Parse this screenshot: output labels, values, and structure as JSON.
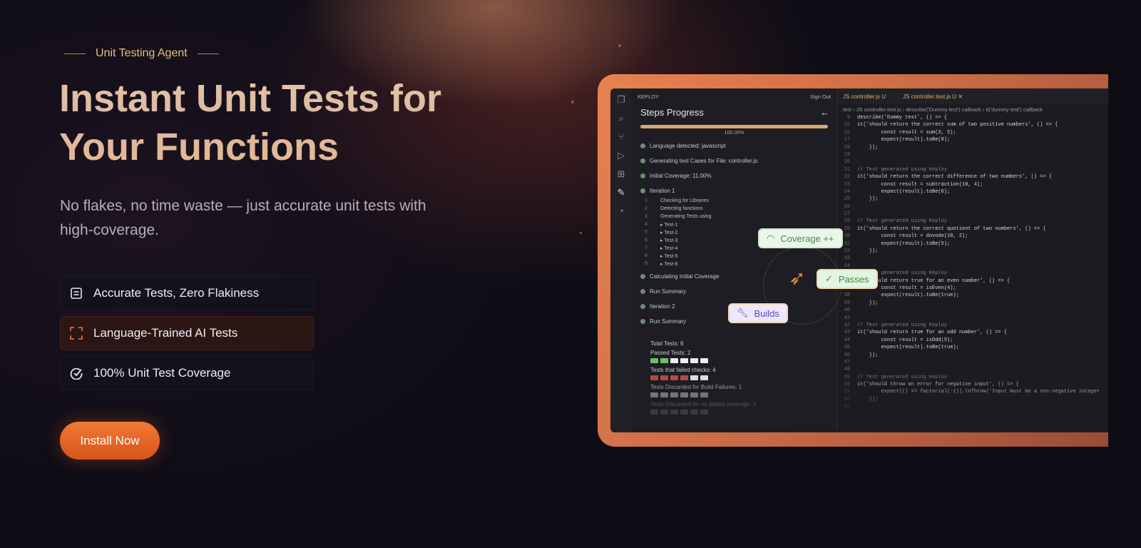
{
  "hero": {
    "eyebrow": "Unit Testing Agent",
    "title_line1": "Instant Unit Tests for",
    "title_line2": "Your Functions",
    "subtitle": "No flakes, no time waste — just accurate unit tests with high-coverage.",
    "features": [
      {
        "label": "Accurate Tests, Zero Flakiness",
        "icon": "document-icon"
      },
      {
        "label": "Language-Trained AI Tests",
        "icon": "scan-icon"
      },
      {
        "label": "100% Unit Test Coverage",
        "icon": "gauge-check-icon"
      }
    ],
    "cta": "Install Now"
  },
  "editor": {
    "panel": {
      "brand": "KEPLOY",
      "sign_out": "Sign Out",
      "title": "Steps Progress",
      "progress_value": "100.00%",
      "steps": [
        "Language detected:  javascript",
        "Generating test Cases for File:  controller.js.",
        "Initial Coverage:  11.00%",
        "Iteration 1"
      ],
      "substeps": [
        {
          "n": "1",
          "t": "Checking for Libraries"
        },
        {
          "n": "2",
          "t": "Detecting functions"
        },
        {
          "n": "3",
          "t": "Generating Tests using"
        },
        {
          "n": "4",
          "t": "▸ Test-1"
        },
        {
          "n": "5",
          "t": "▸ Test-2"
        },
        {
          "n": "6",
          "t": "▸ Test-3"
        },
        {
          "n": "7",
          "t": "▸ Test-4"
        },
        {
          "n": "8",
          "t": "▸ Test-5"
        },
        {
          "n": "9",
          "t": "▸ Test-6"
        }
      ],
      "steps2": [
        "Calculating Initial Coverage",
        "Run Summary",
        "Iteration 2",
        "Run Summary"
      ],
      "total": "Total Tests: 6",
      "passed": "Passed Tests: 2",
      "failed": "Tests that failed checks: 4",
      "discarded_build": "Tests Discarded for Build Failures: 1",
      "discarded_cov": "Tests Discarded for no added coverage: 3"
    },
    "tabs": [
      "JS controller.js U",
      "JS controller.test.js U  ✕"
    ],
    "breadcrumb": "test  ›  JS controller.test.js  ›  describe('Dummy test') callback  ›  it('dummy test') callback",
    "code": [
      {
        "n": "9",
        "t": "describe('Dummy test', () => {"
      },
      {
        "n": "15",
        "t": "it('should return the correct sum of two positive numbers', () => {"
      },
      {
        "n": "16",
        "t": "        const result = sum(3, 5);"
      },
      {
        "n": "17",
        "t": "        expect(result).toBe(8);"
      },
      {
        "n": "18",
        "t": "    });"
      },
      {
        "n": "19",
        "t": ""
      },
      {
        "n": "20",
        "t": ""
      },
      {
        "n": "21",
        "t": "// Test generated using Keploy"
      },
      {
        "n": "22",
        "t": "it('should return the correct difference of two numbers', () => {"
      },
      {
        "n": "23",
        "t": "        const result = subtraction(10, 4);"
      },
      {
        "n": "24",
        "t": "        expect(result).toBe(6);"
      },
      {
        "n": "25",
        "t": "    });"
      },
      {
        "n": "26",
        "t": ""
      },
      {
        "n": "27",
        "t": ""
      },
      {
        "n": "28",
        "t": "// Test generated using Keploy"
      },
      {
        "n": "29",
        "t": "it('should return the correct quotient of two numbers', () => {"
      },
      {
        "n": "30",
        "t": "        const result = dovode(10, 2);"
      },
      {
        "n": "31",
        "t": "        expect(result).toBe(5);"
      },
      {
        "n": "32",
        "t": "    });"
      },
      {
        "n": "33",
        "t": ""
      },
      {
        "n": "34",
        "t": ""
      },
      {
        "n": "35",
        "t": "// Test generated using Keploy"
      },
      {
        "n": "36",
        "t": "it('should return true for an even number', () => {"
      },
      {
        "n": "37",
        "t": "        const result = isEven(4);"
      },
      {
        "n": "38",
        "t": "        expect(result).toBe(true);"
      },
      {
        "n": "39",
        "t": "    });"
      },
      {
        "n": "40",
        "t": ""
      },
      {
        "n": "41",
        "t": ""
      },
      {
        "n": "42",
        "t": "// Test generated using Keploy"
      },
      {
        "n": "43",
        "t": "it('should return true for an odd number', () => {"
      },
      {
        "n": "44",
        "t": "        const result = isOdd(5);"
      },
      {
        "n": "45",
        "t": "        expect(result).toBe(true);"
      },
      {
        "n": "46",
        "t": "    });"
      },
      {
        "n": "47",
        "t": ""
      },
      {
        "n": "48",
        "t": ""
      },
      {
        "n": "49",
        "t": "// Test generated using Keploy"
      },
      {
        "n": "50",
        "t": "it('should throw an error for negative input', () => {"
      },
      {
        "n": "51",
        "t": "        expect(() => factorial(-1)).toThrow('Input must be a non-negative integer"
      },
      {
        "n": "52",
        "t": "    });"
      },
      {
        "n": "53",
        "t": ""
      }
    ],
    "badges": {
      "coverage": "Coverage ++",
      "passes": "Passes",
      "builds": "Builds"
    }
  }
}
